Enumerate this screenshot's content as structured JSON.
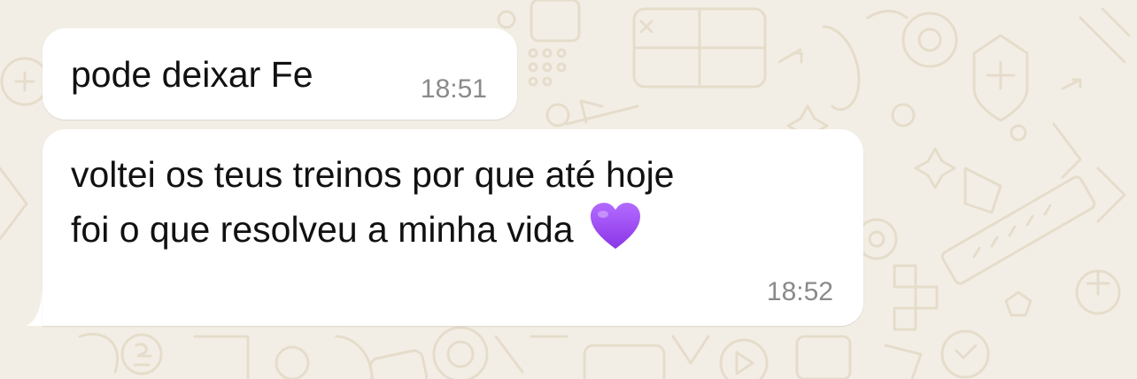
{
  "chat": {
    "messages": [
      {
        "lines": [
          "pode deixar Fe"
        ],
        "time": "18:51"
      },
      {
        "lines": [
          "voltei os teus treinos por que até hoje",
          "foi o que resolveu a minha vida"
        ],
        "emoji": "purple-heart-icon",
        "time": "18:52"
      }
    ]
  },
  "colors": {
    "background": "#f3eee5",
    "bubble": "#ffffff",
    "timestamp": "#8a8a8a",
    "heart": "#9b4ef0"
  }
}
